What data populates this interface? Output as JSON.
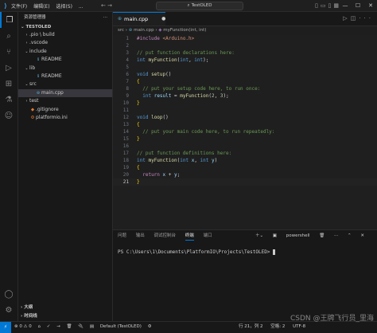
{
  "titlebar": {
    "menus": [
      "文件(F)",
      "编辑(E)",
      "选择(S)",
      "..."
    ],
    "search": "TestOLED",
    "window_controls": [
      "—",
      "☐",
      "✕"
    ]
  },
  "sidebar": {
    "title": "资源管理器",
    "more": "···",
    "project": "TESTOLED",
    "tree": [
      {
        "label": ".pio \\ build",
        "type": "folder",
        "indent": 1,
        "chev": "›",
        "color": "#c5c5c5"
      },
      {
        "label": ".vscode",
        "type": "folder",
        "indent": 1,
        "chev": "›",
        "color": "#c5c5c5"
      },
      {
        "label": "include",
        "type": "folder",
        "indent": 1,
        "chev": "⌄",
        "color": "#c5c5c5"
      },
      {
        "label": "README",
        "type": "file",
        "indent": 2,
        "chev": "",
        "color": "#519aba"
      },
      {
        "label": "lib",
        "type": "folder",
        "indent": 1,
        "chev": "⌄",
        "color": "#c5c5c5"
      },
      {
        "label": "README",
        "type": "file",
        "indent": 2,
        "chev": "",
        "color": "#519aba"
      },
      {
        "label": "src",
        "type": "folder",
        "indent": 1,
        "chev": "⌄",
        "color": "#c5c5c5"
      },
      {
        "label": "main.cpp",
        "type": "cpp",
        "indent": 2,
        "chev": "",
        "color": "#519aba",
        "selected": true
      },
      {
        "label": "test",
        "type": "folder",
        "indent": 1,
        "chev": "›",
        "color": "#c5c5c5"
      },
      {
        "label": ".gitignore",
        "type": "git",
        "indent": 1,
        "chev": "",
        "color": "#e37933"
      },
      {
        "label": "platformio.ini",
        "type": "ini",
        "indent": 1,
        "chev": "",
        "color": "#e37933"
      }
    ],
    "outline": "大纲",
    "timeline": "时间线"
  },
  "tab": {
    "label": "main.cpp",
    "close": "●"
  },
  "breadcrumb": {
    "parts": [
      "src",
      "main.cpp",
      "myFunction(int, int)"
    ]
  },
  "editor_lines": [
    {
      "n": "1",
      "html": "<span class='pp'>#include</span> <span class='st'>&lt;Arduino.h&gt;</span>"
    },
    {
      "n": "2",
      "html": ""
    },
    {
      "n": "3",
      "html": "<span class='cm'>// put function declarations here:</span>"
    },
    {
      "n": "4",
      "html": "<span class='kw'>int</span> <span class='fn'>myFunction</span>(<span class='kw'>int</span>, <span class='kw'>int</span>);"
    },
    {
      "n": "5",
      "html": ""
    },
    {
      "n": "6",
      "html": "<span class='kw'>void</span> <span class='fn'>setup</span>()"
    },
    {
      "n": "7",
      "html": "<span class='br'>{</span>"
    },
    {
      "n": "8",
      "html": "  <span class='cm'>// put your setup code here, to run once:</span>"
    },
    {
      "n": "9",
      "html": "  <span class='kw'>int</span> <span class='vr'>result</span> = <span class='fn'>myFunction</span>(<span class='nm'>2</span>, <span class='nm'>3</span>);"
    },
    {
      "n": "10",
      "html": "<span class='br'>}</span>"
    },
    {
      "n": "11",
      "html": ""
    },
    {
      "n": "12",
      "html": "<span class='kw'>void</span> <span class='fn'>loop</span>()"
    },
    {
      "n": "13",
      "html": "<span class='br'>{</span>"
    },
    {
      "n": "14",
      "html": "  <span class='cm'>// put your main code here, to run repeatedly:</span>"
    },
    {
      "n": "15",
      "html": "<span class='br'>}</span>"
    },
    {
      "n": "16",
      "html": ""
    },
    {
      "n": "17",
      "html": "<span class='cm'>// put function definitions here:</span>"
    },
    {
      "n": "18",
      "html": "<span class='kw'>int</span> <span class='fn'>myFunction</span>(<span class='kw'>int</span> <span class='vr'>x</span>, <span class='kw'>int</span> <span class='vr'>y</span>)"
    },
    {
      "n": "19",
      "html": "<span class='br'>{</span>"
    },
    {
      "n": "20",
      "html": "  <span class='pp'>return</span> <span class='vr'>x</span> + <span class='vr'>y</span>;"
    },
    {
      "n": "21",
      "html": "<span class='br'>}</span>",
      "current": true
    }
  ],
  "panel": {
    "tabs": [
      "问题",
      "输出",
      "调试控制台",
      "终端",
      "端口"
    ],
    "active_tab": 3,
    "shell": "powershell",
    "prompt": "PS C:\\Users\\1\\Documents\\PlatformIO\\Projects\\TestOLED> "
  },
  "statusbar": {
    "remote": "⚡",
    "left": [
      "⊗ 0 ⚠ 0",
      "⌂",
      "✓",
      "→",
      "🗑",
      "🔌",
      "▤",
      "Default (TestOLED)",
      "⚙"
    ],
    "right": [
      "行 21，列 2",
      "空格: 2",
      "UTF-8"
    ],
    "watermark": "CSDN @王牌飞行员_里海"
  }
}
